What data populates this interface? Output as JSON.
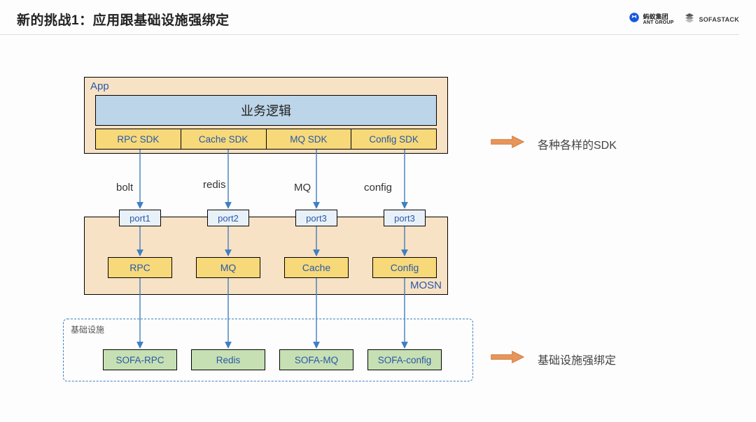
{
  "header": {
    "title": "新的挑战1：应用跟基础设施强绑定",
    "logo_ant_cn": "蚂蚁集团",
    "logo_ant_en": "ANT GROUP",
    "logo_sofa": "SOFASTACK"
  },
  "app": {
    "label": "App",
    "biz": "业务逻辑",
    "sdks": [
      "RPC SDK",
      "Cache SDK",
      "MQ SDK",
      "Config SDK"
    ]
  },
  "protocols": [
    "bolt",
    "redis",
    "MQ",
    "config"
  ],
  "ports": [
    "port1",
    "port2",
    "port3",
    "port3"
  ],
  "mosn": {
    "label": "MOSN",
    "modules": [
      "RPC",
      "MQ",
      "Cache",
      "Config"
    ]
  },
  "infra": {
    "label": "基础设施",
    "services": [
      "SOFA-RPC",
      "Redis",
      "SOFA-MQ",
      "SOFA-config"
    ]
  },
  "callouts": {
    "sdk": "各种各样的SDK",
    "infra": "基础设施强绑定"
  },
  "colors": {
    "peach": "#f8e2c5",
    "yellow": "#f7d97a",
    "lightblue": "#bcd5e8",
    "portblue": "#e9f1f8",
    "green": "#c7e0b3",
    "arrow": "#3f7fbf",
    "bigarrow": "#e0873d"
  },
  "chart_data": {
    "type": "architecture-diagram",
    "layers": [
      {
        "name": "App",
        "contains": [
          "业务逻辑",
          "RPC SDK",
          "Cache SDK",
          "MQ SDK",
          "Config SDK"
        ]
      },
      {
        "name": "protocols",
        "labels": [
          "bolt",
          "redis",
          "MQ",
          "config"
        ]
      },
      {
        "name": "MOSN",
        "ports": [
          "port1",
          "port2",
          "port3",
          "port3"
        ],
        "modules": [
          "RPC",
          "MQ",
          "Cache",
          "Config"
        ]
      },
      {
        "name": "基础设施",
        "services": [
          "SOFA-RPC",
          "Redis",
          "SOFA-MQ",
          "SOFA-config"
        ]
      }
    ],
    "edges": [
      {
        "from": "RPC SDK",
        "to": "port1",
        "label": "bolt"
      },
      {
        "from": "Cache SDK",
        "to": "port2",
        "label": "redis"
      },
      {
        "from": "MQ SDK",
        "to": "port3",
        "label": "MQ"
      },
      {
        "from": "Config SDK",
        "to": "port3",
        "label": "config"
      },
      {
        "from": "port1",
        "to": "RPC"
      },
      {
        "from": "port2",
        "to": "MQ"
      },
      {
        "from": "port3",
        "to": "Cache"
      },
      {
        "from": "port3",
        "to": "Config"
      },
      {
        "from": "RPC",
        "to": "SOFA-RPC"
      },
      {
        "from": "MQ",
        "to": "Redis"
      },
      {
        "from": "Cache",
        "to": "SOFA-MQ"
      },
      {
        "from": "Config",
        "to": "SOFA-config"
      }
    ],
    "annotations": [
      {
        "target": "sdk-row",
        "text": "各种各样的SDK"
      },
      {
        "target": "infra",
        "text": "基础设施强绑定"
      }
    ]
  }
}
